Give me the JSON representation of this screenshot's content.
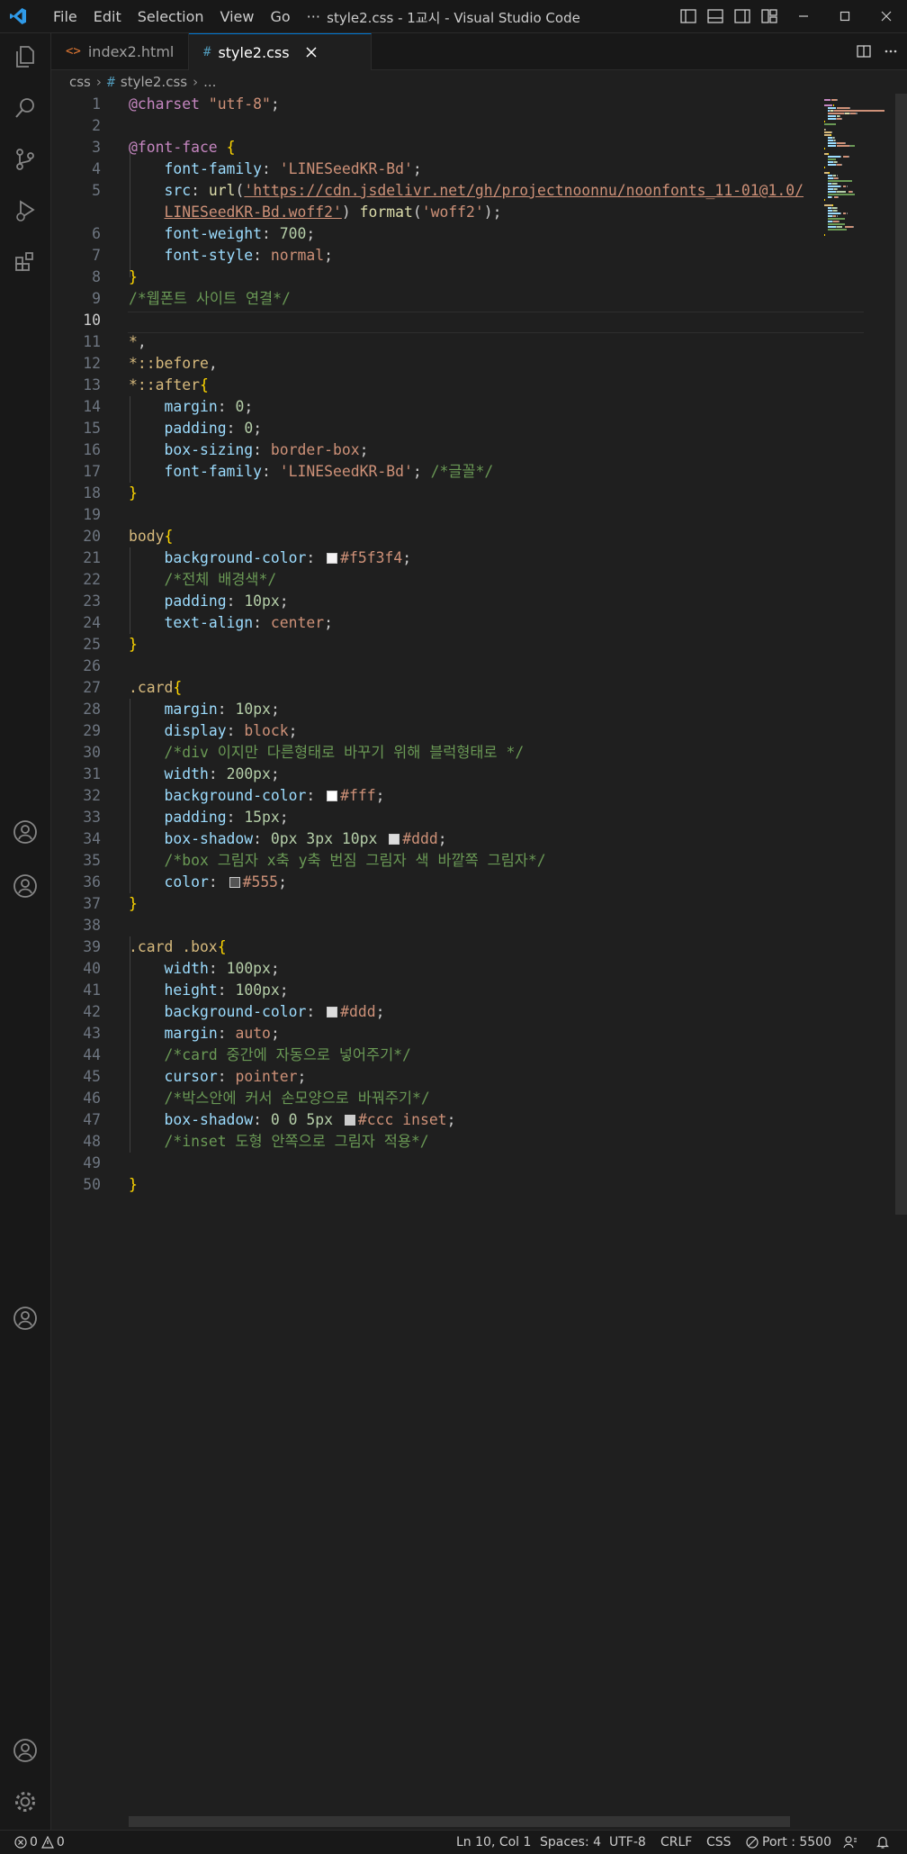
{
  "window": {
    "title": "style2.css - 1교시 - Visual Studio Code",
    "menu": [
      "File",
      "Edit",
      "Selection",
      "View",
      "Go",
      "···"
    ]
  },
  "tabs": [
    {
      "label": "index2.html",
      "icon": "html-file-icon",
      "icon_glyph": "<>",
      "active": false
    },
    {
      "label": "style2.css",
      "icon": "css-file-icon",
      "icon_glyph": "#",
      "active": true
    }
  ],
  "breadcrumb": {
    "folder": "css",
    "file": "style2.css",
    "more": "..."
  },
  "colors": {
    "accent": "#0078d4",
    "editor_bg": "#1f1f1f",
    "chrome_bg": "#181818",
    "keyword": "#c586c0",
    "string": "#ce9178",
    "selector": "#d7ba7d",
    "property": "#9cdcfe",
    "number": "#b5cea8",
    "comment": "#6a9955",
    "function": "#dcdcaa"
  },
  "editor": {
    "current_line": 10,
    "lines": [
      {
        "n": "1",
        "tokens": [
          [
            "at",
            "@charset"
          ],
          [
            "pun",
            " "
          ],
          [
            "str",
            "\"utf-8\""
          ],
          [
            "pun",
            ";"
          ]
        ]
      },
      {
        "n": "2",
        "tokens": []
      },
      {
        "n": "3",
        "tokens": [
          [
            "at",
            "@font-face"
          ],
          [
            "pun",
            " "
          ],
          [
            "brace",
            "{"
          ]
        ]
      },
      {
        "n": "4",
        "tokens": [
          [
            "pun",
            "    "
          ],
          [
            "prop",
            "font-family"
          ],
          [
            "pun",
            ": "
          ],
          [
            "str",
            "'LINESeedKR-Bd'"
          ],
          [
            "pun",
            ";"
          ]
        ]
      },
      {
        "n": "5",
        "tokens": [
          [
            "pun",
            "    "
          ],
          [
            "prop",
            "src"
          ],
          [
            "pun",
            ": "
          ],
          [
            "fn",
            "url"
          ],
          [
            "pun",
            "("
          ],
          [
            "url",
            "'https://cdn.jsdelivr.net/gh/projectnoonnu/noonfonts_11-01@1.0/"
          ]
        ]
      },
      {
        "n": "",
        "tokens": [
          [
            "pun",
            "    "
          ],
          [
            "url",
            "LINESeedKR-Bd.woff2'"
          ],
          [
            "pun",
            ") "
          ],
          [
            "fn",
            "format"
          ],
          [
            "pun",
            "("
          ],
          [
            "str",
            "'woff2'"
          ],
          [
            "pun",
            ");"
          ]
        ]
      },
      {
        "n": "6",
        "tokens": [
          [
            "pun",
            "    "
          ],
          [
            "prop",
            "font-weight"
          ],
          [
            "pun",
            ": "
          ],
          [
            "num",
            "700"
          ],
          [
            "pun",
            ";"
          ]
        ]
      },
      {
        "n": "7",
        "tokens": [
          [
            "pun",
            "    "
          ],
          [
            "prop",
            "font-style"
          ],
          [
            "pun",
            ": "
          ],
          [
            "val",
            "normal"
          ],
          [
            "pun",
            ";"
          ]
        ]
      },
      {
        "n": "8",
        "tokens": [
          [
            "brace",
            "}"
          ]
        ]
      },
      {
        "n": "9",
        "tokens": [
          [
            "cmt",
            "/*웹폰트 사이트 연결*/"
          ]
        ]
      },
      {
        "n": "10",
        "tokens": []
      },
      {
        "n": "11",
        "tokens": [
          [
            "sel",
            "*"
          ],
          [
            "pun",
            ","
          ]
        ]
      },
      {
        "n": "12",
        "tokens": [
          [
            "sel",
            "*::before"
          ],
          [
            "pun",
            ","
          ]
        ]
      },
      {
        "n": "13",
        "tokens": [
          [
            "sel",
            "*::after"
          ],
          [
            "brace",
            "{"
          ]
        ]
      },
      {
        "n": "14",
        "tokens": [
          [
            "pun",
            "    "
          ],
          [
            "prop",
            "margin"
          ],
          [
            "pun",
            ": "
          ],
          [
            "num",
            "0"
          ],
          [
            "pun",
            ";"
          ]
        ]
      },
      {
        "n": "15",
        "tokens": [
          [
            "pun",
            "    "
          ],
          [
            "prop",
            "padding"
          ],
          [
            "pun",
            ": "
          ],
          [
            "num",
            "0"
          ],
          [
            "pun",
            ";"
          ]
        ]
      },
      {
        "n": "16",
        "tokens": [
          [
            "pun",
            "    "
          ],
          [
            "prop",
            "box-sizing"
          ],
          [
            "pun",
            ": "
          ],
          [
            "val",
            "border-box"
          ],
          [
            "pun",
            ";"
          ]
        ]
      },
      {
        "n": "17",
        "tokens": [
          [
            "pun",
            "    "
          ],
          [
            "prop",
            "font-family"
          ],
          [
            "pun",
            ": "
          ],
          [
            "str",
            "'LINESeedKR-Bd'"
          ],
          [
            "pun",
            "; "
          ],
          [
            "cmt",
            "/*글꼴*/"
          ]
        ]
      },
      {
        "n": "18",
        "tokens": [
          [
            "brace",
            "}"
          ]
        ]
      },
      {
        "n": "19",
        "tokens": []
      },
      {
        "n": "20",
        "tokens": [
          [
            "sel",
            "body"
          ],
          [
            "brace",
            "{"
          ]
        ]
      },
      {
        "n": "21",
        "tokens": [
          [
            "pun",
            "    "
          ],
          [
            "prop",
            "background-color"
          ],
          [
            "pun",
            ": "
          ],
          [
            "swatch",
            "#f5f3f4"
          ],
          [
            "val",
            "#f5f3f4"
          ],
          [
            "pun",
            ";"
          ]
        ]
      },
      {
        "n": "22",
        "tokens": [
          [
            "pun",
            "    "
          ],
          [
            "cmt",
            "/*전체 배경색*/"
          ]
        ]
      },
      {
        "n": "23",
        "tokens": [
          [
            "pun",
            "    "
          ],
          [
            "prop",
            "padding"
          ],
          [
            "pun",
            ": "
          ],
          [
            "num",
            "10px"
          ],
          [
            "pun",
            ";"
          ]
        ]
      },
      {
        "n": "24",
        "tokens": [
          [
            "pun",
            "    "
          ],
          [
            "prop",
            "text-align"
          ],
          [
            "pun",
            ": "
          ],
          [
            "val",
            "center"
          ],
          [
            "pun",
            ";"
          ]
        ]
      },
      {
        "n": "25",
        "tokens": [
          [
            "brace",
            "}"
          ]
        ]
      },
      {
        "n": "26",
        "tokens": []
      },
      {
        "n": "27",
        "tokens": [
          [
            "sel",
            ".card"
          ],
          [
            "brace",
            "{"
          ]
        ]
      },
      {
        "n": "28",
        "tokens": [
          [
            "pun",
            "    "
          ],
          [
            "prop",
            "margin"
          ],
          [
            "pun",
            ": "
          ],
          [
            "num",
            "10px"
          ],
          [
            "pun",
            ";"
          ]
        ]
      },
      {
        "n": "29",
        "tokens": [
          [
            "pun",
            "    "
          ],
          [
            "prop",
            "display"
          ],
          [
            "pun",
            ": "
          ],
          [
            "val",
            "block"
          ],
          [
            "pun",
            ";"
          ]
        ]
      },
      {
        "n": "30",
        "tokens": [
          [
            "pun",
            "    "
          ],
          [
            "cmt",
            "/*div 이지만 다른형태로 바꾸기 위해 블럭형태로 */"
          ]
        ]
      },
      {
        "n": "31",
        "tokens": [
          [
            "pun",
            "    "
          ],
          [
            "prop",
            "width"
          ],
          [
            "pun",
            ": "
          ],
          [
            "num",
            "200px"
          ],
          [
            "pun",
            ";"
          ]
        ]
      },
      {
        "n": "32",
        "tokens": [
          [
            "pun",
            "    "
          ],
          [
            "prop",
            "background-color"
          ],
          [
            "pun",
            ": "
          ],
          [
            "swatch",
            "#ffffff"
          ],
          [
            "val",
            "#fff"
          ],
          [
            "pun",
            ";"
          ]
        ]
      },
      {
        "n": "33",
        "tokens": [
          [
            "pun",
            "    "
          ],
          [
            "prop",
            "padding"
          ],
          [
            "pun",
            ": "
          ],
          [
            "num",
            "15px"
          ],
          [
            "pun",
            ";"
          ]
        ]
      },
      {
        "n": "34",
        "tokens": [
          [
            "pun",
            "    "
          ],
          [
            "prop",
            "box-shadow"
          ],
          [
            "pun",
            ": "
          ],
          [
            "num",
            "0px 3px 10px"
          ],
          [
            "pun",
            " "
          ],
          [
            "swatch",
            "#dddddd"
          ],
          [
            "val",
            "#ddd"
          ],
          [
            "pun",
            ";"
          ]
        ]
      },
      {
        "n": "35",
        "tokens": [
          [
            "pun",
            "    "
          ],
          [
            "cmt",
            "/*box 그림자 x축 y축 번짐 그림자 색 바깥쪽 그림자*/"
          ]
        ]
      },
      {
        "n": "36",
        "tokens": [
          [
            "pun",
            "    "
          ],
          [
            "prop",
            "color"
          ],
          [
            "pun",
            ": "
          ],
          [
            "swatch",
            "#555555"
          ],
          [
            "val",
            "#555"
          ],
          [
            "pun",
            ";"
          ]
        ]
      },
      {
        "n": "37",
        "tokens": [
          [
            "brace",
            "}"
          ]
        ]
      },
      {
        "n": "38",
        "tokens": []
      },
      {
        "n": "39",
        "tokens": [
          [
            "sel",
            ".card .box"
          ],
          [
            "brace",
            "{"
          ]
        ]
      },
      {
        "n": "40",
        "tokens": [
          [
            "pun",
            "    "
          ],
          [
            "prop",
            "width"
          ],
          [
            "pun",
            ": "
          ],
          [
            "num",
            "100px"
          ],
          [
            "pun",
            ";"
          ]
        ]
      },
      {
        "n": "41",
        "tokens": [
          [
            "pun",
            "    "
          ],
          [
            "prop",
            "height"
          ],
          [
            "pun",
            ": "
          ],
          [
            "num",
            "100px"
          ],
          [
            "pun",
            ";"
          ]
        ]
      },
      {
        "n": "42",
        "tokens": [
          [
            "pun",
            "    "
          ],
          [
            "prop",
            "background-color"
          ],
          [
            "pun",
            ": "
          ],
          [
            "swatch",
            "#dddddd"
          ],
          [
            "val",
            "#ddd"
          ],
          [
            "pun",
            ";"
          ]
        ]
      },
      {
        "n": "43",
        "tokens": [
          [
            "pun",
            "    "
          ],
          [
            "prop",
            "margin"
          ],
          [
            "pun",
            ": "
          ],
          [
            "val",
            "auto"
          ],
          [
            "pun",
            ";"
          ]
        ]
      },
      {
        "n": "44",
        "tokens": [
          [
            "pun",
            "    "
          ],
          [
            "cmt",
            "/*card 중간에 자동으로 넣어주기*/"
          ]
        ]
      },
      {
        "n": "45",
        "tokens": [
          [
            "pun",
            "    "
          ],
          [
            "prop",
            "cursor"
          ],
          [
            "pun",
            ": "
          ],
          [
            "val",
            "pointer"
          ],
          [
            "pun",
            ";"
          ]
        ]
      },
      {
        "n": "46",
        "tokens": [
          [
            "pun",
            "    "
          ],
          [
            "cmt",
            "/*박스안에 커서 손모양으로 바꿔주기*/"
          ]
        ]
      },
      {
        "n": "47",
        "tokens": [
          [
            "pun",
            "    "
          ],
          [
            "prop",
            "box-shadow"
          ],
          [
            "pun",
            ": "
          ],
          [
            "num",
            "0 0 5px"
          ],
          [
            "pun",
            " "
          ],
          [
            "swatch",
            "#cccccc"
          ],
          [
            "val",
            "#ccc inset"
          ],
          [
            "pun",
            ";"
          ]
        ]
      },
      {
        "n": "48",
        "tokens": [
          [
            "pun",
            "    "
          ],
          [
            "cmt",
            "/*inset 도형 안쪽으로 그림자 적용*/"
          ]
        ]
      },
      {
        "n": "49",
        "tokens": []
      },
      {
        "n": "50",
        "tokens": [
          [
            "brace",
            "}"
          ]
        ]
      }
    ]
  },
  "status": {
    "errors": "0",
    "warnings": "0",
    "position": "Ln 10, Col 1",
    "spaces": "Spaces: 4",
    "encoding": "UTF-8",
    "eol": "CRLF",
    "language": "CSS",
    "port": "Port : 5500"
  }
}
